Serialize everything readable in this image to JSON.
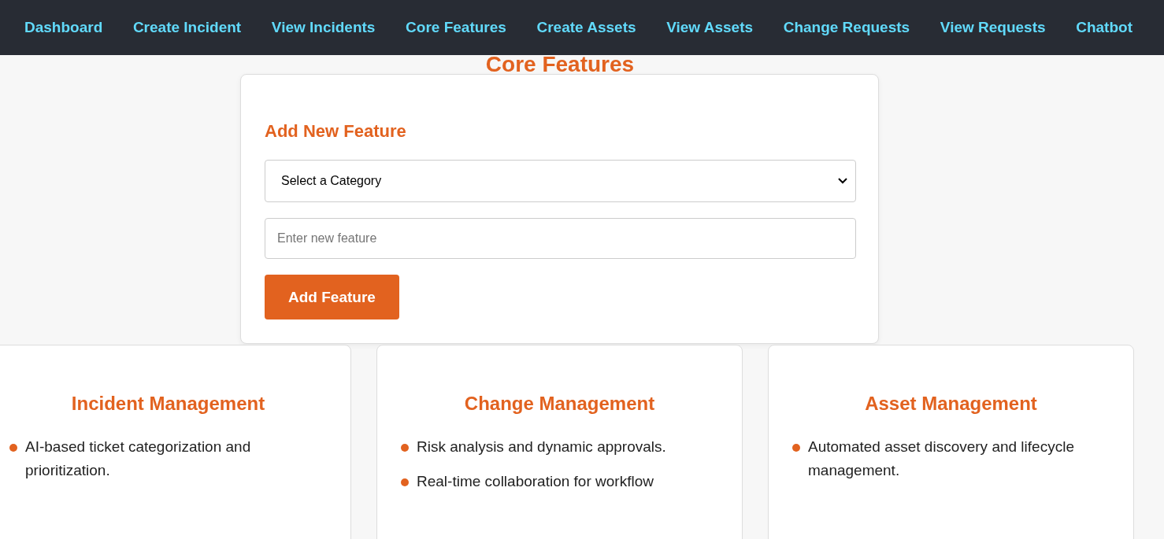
{
  "nav": [
    {
      "label": "Dashboard"
    },
    {
      "label": "Create Incident"
    },
    {
      "label": "View Incidents"
    },
    {
      "label": "Core Features"
    },
    {
      "label": "Create Assets"
    },
    {
      "label": "View Assets"
    },
    {
      "label": "Change Requests"
    },
    {
      "label": "View Requests"
    },
    {
      "label": "Chatbot"
    }
  ],
  "page_title": "Core Features",
  "form": {
    "title": "Add New Feature",
    "category_select": {
      "value": "Select a Category"
    },
    "feature_input": {
      "placeholder": "Enter new feature"
    },
    "button": "Add Feature"
  },
  "cards": [
    {
      "title": "Incident Management",
      "items": [
        "AI-based ticket categorization and prioritization."
      ]
    },
    {
      "title": "Change Management",
      "items": [
        "Risk analysis and dynamic approvals.",
        "Real-time collaboration for workflow"
      ]
    },
    {
      "title": "Asset Management",
      "items": [
        "Automated asset discovery and lifecycle management."
      ]
    }
  ]
}
